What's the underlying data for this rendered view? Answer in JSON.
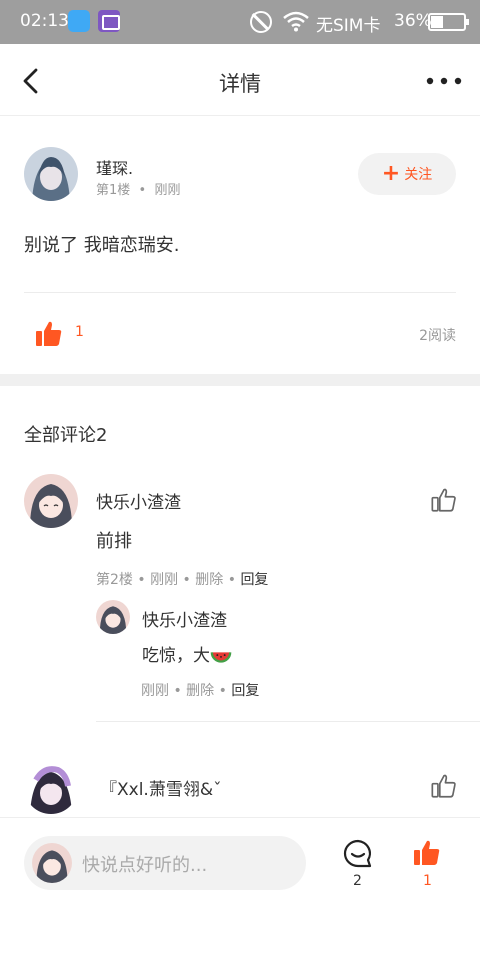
{
  "status_bar": {
    "time": "02:13",
    "carrier": "无SIM卡",
    "battery": "36%",
    "battery_level": 0.36
  },
  "nav": {
    "back_icon": "back-chevron-icon",
    "title": "详情",
    "more_icon": "more-dots-icon"
  },
  "post": {
    "author": "瑾琛.",
    "floor": "第1楼",
    "time": "刚刚",
    "follow_label": "关注",
    "content": "别说了 我暗恋瑞安.",
    "like_count": "1",
    "reads": "2阅读"
  },
  "comments": {
    "header": "全部评论2",
    "items": [
      {
        "name": "快乐小渣渣",
        "text": "前排",
        "floor": "第2楼",
        "time": "刚刚",
        "delete": "删除",
        "reply": "回复",
        "replies": [
          {
            "name": "快乐小渣渣",
            "text": "吃惊，大",
            "time": "刚刚",
            "delete": "删除",
            "reply": "回复"
          }
        ]
      },
      {
        "name": "『Xxl.萧雪翎&ˇ"
      }
    ]
  },
  "bottom_bar": {
    "placeholder": "快说点好听的...",
    "comment_count": "2",
    "like_count": "1"
  },
  "colors": {
    "accent": "#ff5722",
    "status_bar": "#9e9e9e",
    "muted_text": "#999999",
    "pill_bg": "#f2f2f2"
  }
}
